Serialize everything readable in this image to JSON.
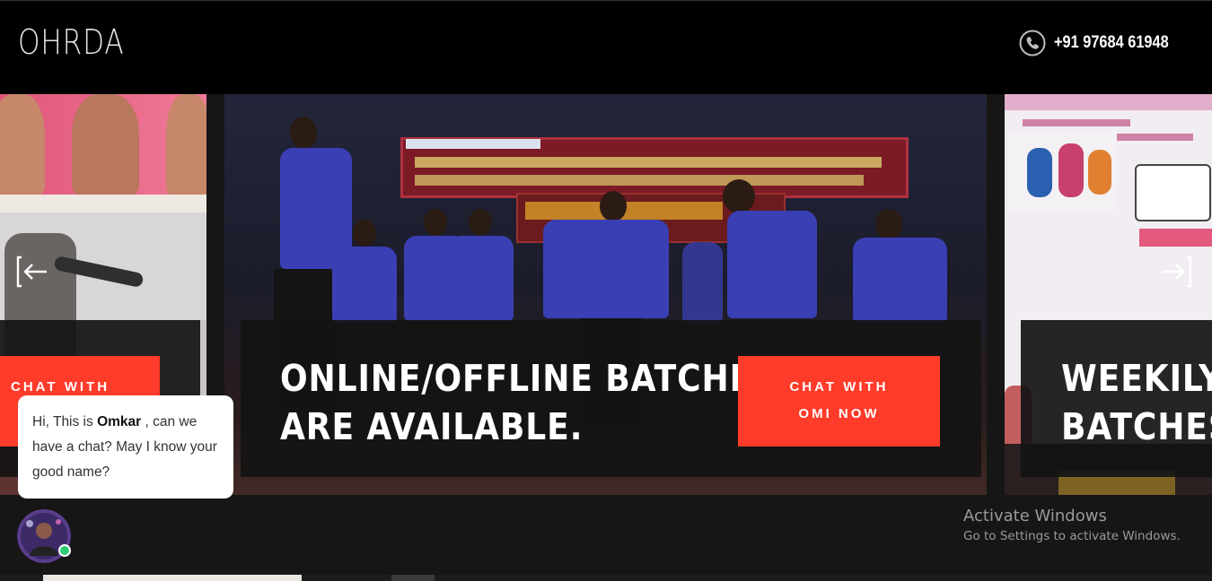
{
  "header": {
    "logo": "OHRDA",
    "phone_icon": "phone-icon",
    "phone_number": "+91 97684 61948"
  },
  "carousel": {
    "prev_icon": "arrow-left-icon",
    "next_icon": "arrow-right-icon",
    "slides": [
      {
        "cta": "CHAT WITH",
        "headline_lines": []
      },
      {
        "headline_lines": [
          "ONLINE/OFFLINE BATCHES",
          "ARE AVAILABLE."
        ],
        "cta_line1": "CHAT WITH",
        "cta_line2": "OMI NOW"
      },
      {
        "headline_lines": [
          "WEEKILY &",
          "BATCHES."
        ]
      }
    ]
  },
  "chat": {
    "greeting_prefix": "Hi, This is ",
    "agent_name": "Omkar",
    "greeting_suffix": " , can we have a chat? May I know your good name?",
    "online_status_color": "#2ecc71"
  },
  "os_watermark": {
    "title": "Activate Windows",
    "subtitle": "Go to Settings to activate Windows."
  },
  "colors": {
    "accent": "#ff3b2a",
    "header_bg": "#000000",
    "panel_bg": "#141414"
  }
}
